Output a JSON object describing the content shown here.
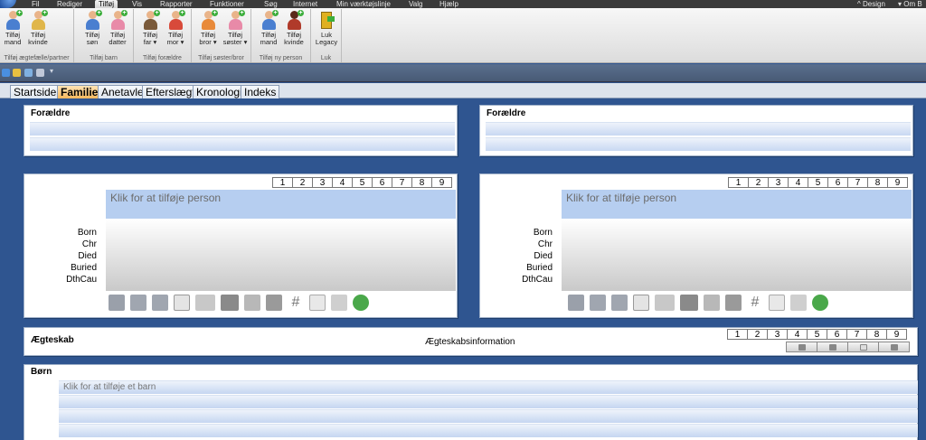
{
  "menu": {
    "items": [
      "Fil",
      "Rediger",
      "Tilføj",
      "Vis",
      "Rapporter",
      "Funktioner",
      "Søg",
      "Internet",
      "Min værktøjslinje",
      "Valg",
      "Hjælp"
    ],
    "active": "Tilføj",
    "right": [
      "Design",
      "Om B"
    ]
  },
  "ribbon": {
    "groups": [
      {
        "label": "Tilføj ægtefælle/partner",
        "buttons": [
          {
            "l1": "Tilføj",
            "l2": "mand",
            "color": "#4a7fd0"
          },
          {
            "l1": "Tilføj",
            "l2": "kvinde",
            "color": "#e0b64a"
          }
        ]
      },
      {
        "label": "Tilføj barn",
        "buttons": [
          {
            "l1": "Tilføj",
            "l2": "søn",
            "color": "#4a7fd0"
          },
          {
            "l1": "Tilføj",
            "l2": "datter",
            "color": "#e88aa8"
          }
        ]
      },
      {
        "label": "Tilføj forældre",
        "buttons": [
          {
            "l1": "Tilføj",
            "l2": "far ▾",
            "color": "#7a5a3a"
          },
          {
            "l1": "Tilføj",
            "l2": "mor ▾",
            "color": "#d84a3a"
          }
        ]
      },
      {
        "label": "Tilføj søster/bror",
        "buttons": [
          {
            "l1": "Tilføj",
            "l2": "bror ▾",
            "color": "#e88a3a"
          },
          {
            "l1": "Tilføj",
            "l2": "søster ▾",
            "color": "#e88aa8"
          }
        ]
      },
      {
        "label": "Tilføj ny person",
        "buttons": [
          {
            "l1": "Tilføj",
            "l2": "mand",
            "color": "#4a7fd0"
          },
          {
            "l1": "Tilføj",
            "l2": "kvinde",
            "color": "#b03a2a"
          }
        ]
      },
      {
        "label": "Luk",
        "buttons": [
          {
            "l1": "Luk",
            "l2": "Legacy",
            "color": "#e0b020"
          }
        ]
      }
    ]
  },
  "tabs": [
    "Startside",
    "Familie",
    "Anetavle",
    "Efterslægt",
    "Kronologi",
    "Indeks"
  ],
  "active_tab": "Familie",
  "parents_left": {
    "title": "Forældre"
  },
  "parents_right": {
    "title": "Forældre"
  },
  "numbers": [
    "1",
    "2",
    "3",
    "4",
    "5",
    "6",
    "7",
    "8",
    "9"
  ],
  "person_left": {
    "placeholder": "Klik for at tilføje person"
  },
  "person_right": {
    "placeholder": "Klik for at tilføje person"
  },
  "events": [
    "Born",
    "Chr",
    "Died",
    "Buried",
    "DthCau"
  ],
  "toolbar_icons": [
    "parents-icon",
    "siblings-icon",
    "spouses-icon",
    "notes-icon",
    "book-icon",
    "picture-icon",
    "library-icon",
    "edit-icon",
    "hash-icon",
    "document-icon",
    "map-icon",
    "user-search-icon"
  ],
  "marriage": {
    "title": "Ægteskab",
    "info": "Ægteskabsinformation"
  },
  "children": {
    "title": "Børn",
    "placeholder": "Klik for at tilføje et barn"
  },
  "colors": {
    "background": "#2f5590",
    "accent": "#f6b75c",
    "name_box": "#b6cef0"
  }
}
